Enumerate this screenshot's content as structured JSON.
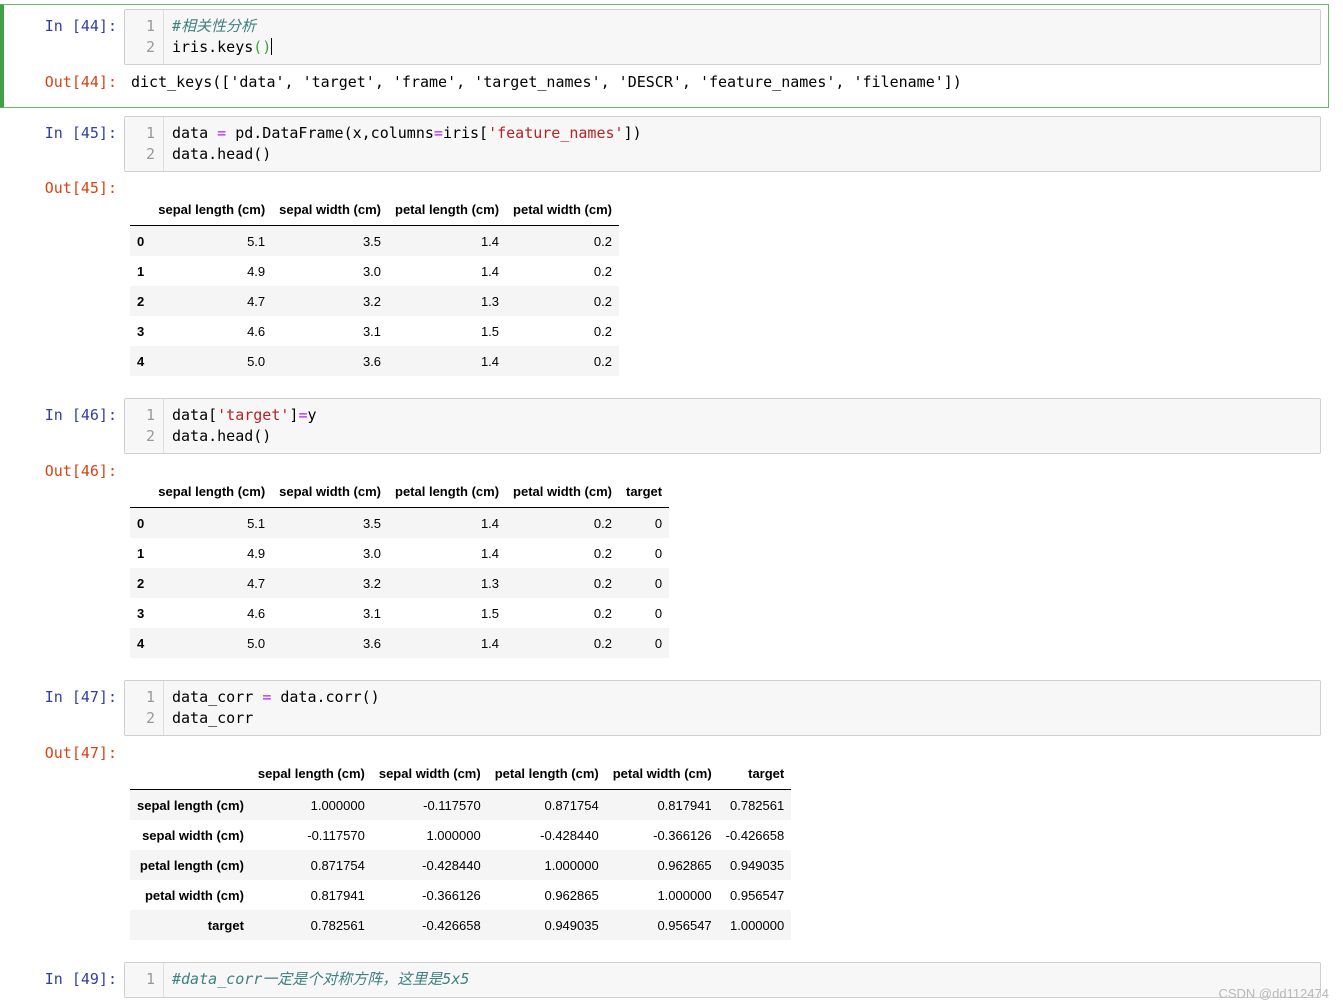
{
  "cells": {
    "c44": {
      "in_prompt": "In [44]:",
      "lines": [
        "1",
        "2"
      ],
      "code1": "#相关性分析",
      "code2_a": "iris.keys",
      "code2_b": "()",
      "out_prompt": "Out[44]:",
      "output": "dict_keys(['data', 'target', 'frame', 'target_names', 'DESCR', 'feature_names', 'filename'])"
    },
    "c45": {
      "in_prompt": "In [45]:",
      "lines": [
        "1",
        "2"
      ],
      "code1_a": "data ",
      "code1_op": "=",
      "code1_b": " pd.DataFrame(x,columns",
      "code1_op2": "=",
      "code1_c": "iris[",
      "code1_str": "'feature_names'",
      "code1_d": "])",
      "code2": "data.head()",
      "out_prompt": "Out[45]:"
    },
    "c46": {
      "in_prompt": "In [46]:",
      "lines": [
        "1",
        "2"
      ],
      "code1_a": "data[",
      "code1_str": "'target'",
      "code1_b": "]",
      "code1_op": "=",
      "code1_c": "y",
      "code2": "data.head()",
      "out_prompt": "Out[46]:"
    },
    "c47": {
      "in_prompt": "In [47]:",
      "lines": [
        "1",
        "2"
      ],
      "code1_a": "data_corr ",
      "code1_op": "=",
      "code1_b": " data.corr()",
      "code2": "data_corr",
      "out_prompt": "Out[47]:"
    },
    "c49": {
      "in_prompt": "In [49]:",
      "lines": [
        "1"
      ],
      "code1": "#data_corr一定是个对称方阵，这里是5x5"
    }
  },
  "df45": {
    "columns": [
      "",
      "sepal length (cm)",
      "sepal width (cm)",
      "petal length (cm)",
      "petal width (cm)"
    ],
    "rows": [
      [
        "0",
        "5.1",
        "3.5",
        "1.4",
        "0.2"
      ],
      [
        "1",
        "4.9",
        "3.0",
        "1.4",
        "0.2"
      ],
      [
        "2",
        "4.7",
        "3.2",
        "1.3",
        "0.2"
      ],
      [
        "3",
        "4.6",
        "3.1",
        "1.5",
        "0.2"
      ],
      [
        "4",
        "5.0",
        "3.6",
        "1.4",
        "0.2"
      ]
    ]
  },
  "df46": {
    "columns": [
      "",
      "sepal length (cm)",
      "sepal width (cm)",
      "petal length (cm)",
      "petal width (cm)",
      "target"
    ],
    "rows": [
      [
        "0",
        "5.1",
        "3.5",
        "1.4",
        "0.2",
        "0"
      ],
      [
        "1",
        "4.9",
        "3.0",
        "1.4",
        "0.2",
        "0"
      ],
      [
        "2",
        "4.7",
        "3.2",
        "1.3",
        "0.2",
        "0"
      ],
      [
        "3",
        "4.6",
        "3.1",
        "1.5",
        "0.2",
        "0"
      ],
      [
        "4",
        "5.0",
        "3.6",
        "1.4",
        "0.2",
        "0"
      ]
    ]
  },
  "df47": {
    "columns": [
      "",
      "sepal length (cm)",
      "sepal width (cm)",
      "petal length (cm)",
      "petal width (cm)",
      "target"
    ],
    "rows": [
      [
        "sepal length (cm)",
        "1.000000",
        "-0.117570",
        "0.871754",
        "0.817941",
        "0.782561"
      ],
      [
        "sepal width (cm)",
        "-0.117570",
        "1.000000",
        "-0.428440",
        "-0.366126",
        "-0.426658"
      ],
      [
        "petal length (cm)",
        "0.871754",
        "-0.428440",
        "1.000000",
        "0.962865",
        "0.949035"
      ],
      [
        "petal width (cm)",
        "0.817941",
        "-0.366126",
        "0.962865",
        "1.000000",
        "0.956547"
      ],
      [
        "target",
        "0.782561",
        "-0.426658",
        "0.949035",
        "0.956547",
        "1.000000"
      ]
    ]
  },
  "watermark": "CSDN @dd112474"
}
